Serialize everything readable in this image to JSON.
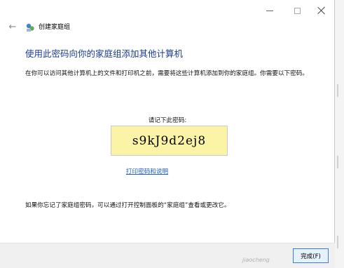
{
  "window": {
    "title": "创建家庭组"
  },
  "content": {
    "heading": "使用此密码向你的家庭组添加其他计算机",
    "description": "在你可以访问其他计算机上的文件和打印机之前，需要将这些计算机添加到你的家庭组。你需要以下密码。",
    "password_label": "请记下此密码:",
    "password": "s9kJ9d2ej8",
    "print_link": "打印密码和说明",
    "note": "如果你忘记了家庭组密码，可以通过打开控制面板的“家庭组”查看或更改它。"
  },
  "footer": {
    "finish_label": "完成(F)"
  },
  "watermark": "jiaocheng"
}
